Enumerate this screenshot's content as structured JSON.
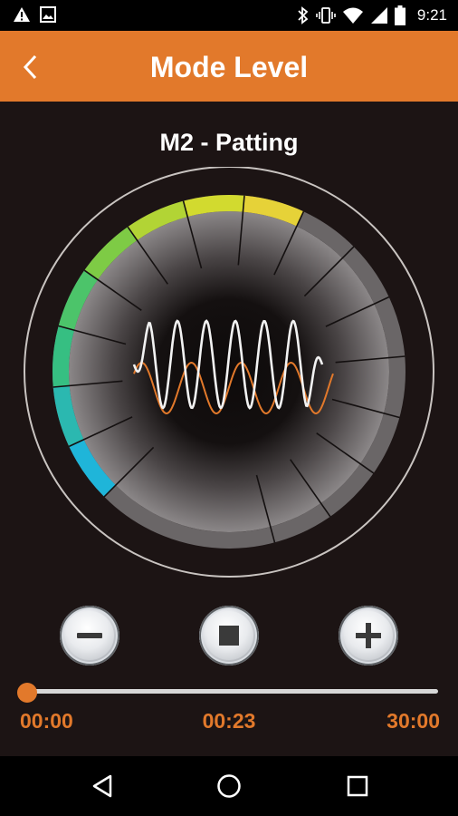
{
  "status_bar": {
    "time": "9:21",
    "left_icons": [
      "warning-icon",
      "image-icon"
    ],
    "right_icons": [
      "bluetooth-icon",
      "vibrate-icon",
      "wifi-icon",
      "signal-icon",
      "battery-icon"
    ]
  },
  "app_bar": {
    "title": "Mode Level",
    "back_icon": "back-chevron-icon",
    "background": "#e2792b"
  },
  "mode": {
    "title": "M2 - Patting"
  },
  "intensity_dial": {
    "level": 8,
    "max_level": 15,
    "segment_colors": [
      "#1fb5d9",
      "#2bb8b0",
      "#36bf82",
      "#4cc46a",
      "#7ecb45",
      "#b2d435",
      "#d2da2f",
      "#e6d238",
      "#f0b83c"
    ]
  },
  "controls": {
    "decrease_icon": "minus-icon",
    "stop_icon": "stop-icon",
    "increase_icon": "plus-icon"
  },
  "timer": {
    "start_label": "00:00",
    "current_label": "00:23",
    "end_label": "30:00",
    "progress_fraction": 0.0
  },
  "nav_bar": {
    "icons": [
      "back-triangle-icon",
      "home-circle-icon",
      "recents-square-icon"
    ]
  },
  "colors": {
    "accent": "#e2792b",
    "background": "#1c1414"
  }
}
